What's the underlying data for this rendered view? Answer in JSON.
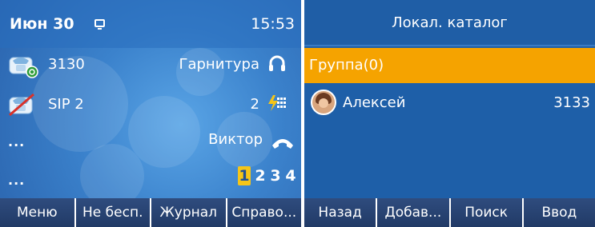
{
  "left_screen": {
    "status_bar": {
      "date": "Июн 30",
      "time": "15:53"
    },
    "lines": [
      {
        "label": "3130",
        "icon": "registered-phone-icon"
      },
      {
        "label": "SIP 2",
        "icon": "unregistered-phone-icon"
      },
      {
        "label": "..."
      },
      {
        "label": "..."
      }
    ],
    "right_items": {
      "headset": "Гарнитура",
      "missed_count": "2",
      "caller": "Виктор"
    },
    "pages": [
      "1",
      "2",
      "3",
      "4"
    ],
    "active_page": "1",
    "softkeys": [
      "Меню",
      "Не бесп.",
      "Журнал",
      "Справо..."
    ]
  },
  "right_screen": {
    "title": "Локал. каталог",
    "group": "Группа(0)",
    "contacts": [
      {
        "name": "Алексей",
        "number": "3133"
      }
    ],
    "softkeys": [
      "Назад",
      "Добав...",
      "Поиск",
      "Ввод"
    ]
  },
  "colors": {
    "accent_orange": "#f5a300",
    "screen_blue": "#1e5fa8",
    "softkey_bar": "#2a4272",
    "active_page_yellow": "#f5c518"
  }
}
